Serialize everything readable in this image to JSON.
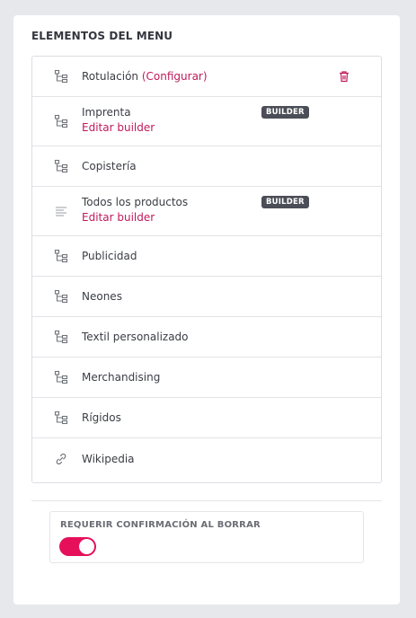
{
  "section": {
    "title": "ELEMENTOS DEL MENU"
  },
  "colors": {
    "accent": "#c0195a",
    "toggle_on": "#e6105a",
    "badge_bg": "#4b4e56",
    "trash": "#c0195a"
  },
  "menu": {
    "items": [
      {
        "icon": "sitemap-icon",
        "label": "Rotulación",
        "config_link": "(Configurar)",
        "delete": "trash-icon"
      },
      {
        "icon": "sitemap-icon",
        "label": "Imprenta",
        "badge": "BUILDER",
        "link": "Editar builder"
      },
      {
        "icon": "sitemap-icon",
        "label": "Copistería"
      },
      {
        "icon": "align-left-icon",
        "label": "Todos los productos",
        "badge": "BUILDER",
        "link": "Editar builder"
      },
      {
        "icon": "sitemap-icon",
        "label": "Publicidad"
      },
      {
        "icon": "sitemap-icon",
        "label": "Neones"
      },
      {
        "icon": "sitemap-icon",
        "label": "Textil personalizado"
      },
      {
        "icon": "sitemap-icon",
        "label": "Merchandising"
      },
      {
        "icon": "sitemap-icon",
        "label": "Rígidos"
      },
      {
        "icon": "link-icon",
        "label": "Wikipedia"
      }
    ]
  },
  "confirm": {
    "label": "REQUERIR CONFIRMACIÓN AL BORRAR",
    "enabled": true
  }
}
